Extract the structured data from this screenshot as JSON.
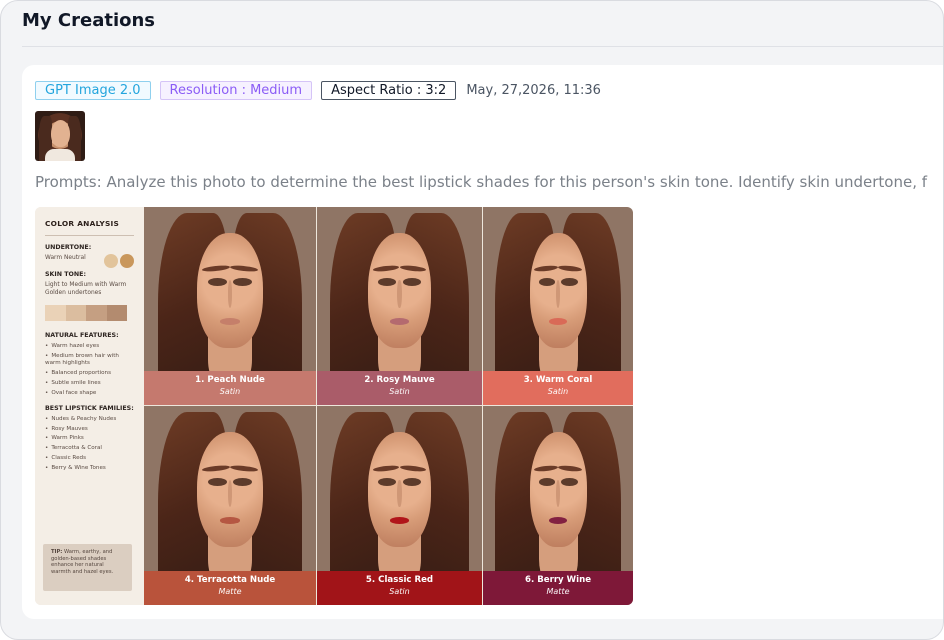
{
  "page": {
    "title": "My Creations"
  },
  "creation": {
    "tags": {
      "model": "GPT Image 2.0",
      "resolution": "Resolution : Medium",
      "aspect": "Aspect Ratio : 3:2"
    },
    "date": "May, 27,2026, 11:36",
    "prompt": "Prompts: Analyze this photo to determine the best lipstick shades for this person's skin tone. Identify skin undertone, f"
  },
  "analysis": {
    "title": "COLOR ANALYSIS",
    "undertone_label": "UNDERTONE:",
    "undertone_value": "Warm Neutral",
    "undertone_colors": [
      "#e2c49b",
      "#c9975c"
    ],
    "skin_label": "SKIN TONE:",
    "skin_value": "Light to Medium with Warm Golden undertones",
    "skin_swatches": [
      "#ead2b7",
      "#dbbd9f",
      "#c59f82",
      "#b38b6f"
    ],
    "features_label": "NATURAL FEATURES:",
    "features": [
      "Warm hazel eyes",
      "Medium brown hair with warm highlights",
      "Balanced proportions",
      "Subtle smile lines",
      "Oval face shape"
    ],
    "families_label": "BEST LIPSTICK FAMILIES:",
    "families": [
      "Nudes & Peachy Nudes",
      "Rosy Mauves",
      "Warm Pinks",
      "Terracotta & Coral",
      "Classic Reds",
      "Berry & Wine Tones"
    ],
    "tip_label": "TIP:",
    "tip_text": "Warm, earthy, and golden-based shades enhance her natural warmth and hazel eyes."
  },
  "shades": [
    {
      "name": "1. Peach Nude",
      "finish": "Satin",
      "caption_color": "#c5796e",
      "lip_color": "#c57f6a"
    },
    {
      "name": "2. Rosy Mauve",
      "finish": "Satin",
      "caption_color": "#aa5c69",
      "lip_color": "#b46a6f"
    },
    {
      "name": "3. Warm Coral",
      "finish": "Satin",
      "caption_color": "#e16d5d",
      "lip_color": "#d96a57"
    },
    {
      "name": "4. Terracotta Nude",
      "finish": "Matte",
      "caption_color": "#b9533b",
      "lip_color": "#b55742"
    },
    {
      "name": "5. Classic Red",
      "finish": "Satin",
      "caption_color": "#a11418",
      "lip_color": "#b1151a"
    },
    {
      "name": "6. Berry Wine",
      "finish": "Matte",
      "caption_color": "#7e1838",
      "lip_color": "#822141"
    }
  ]
}
